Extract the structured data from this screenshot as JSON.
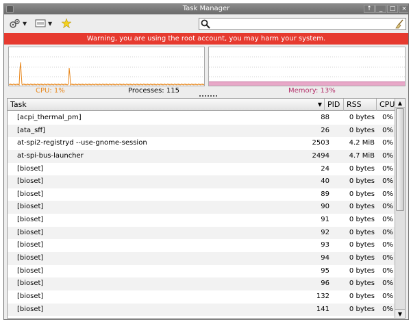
{
  "window": {
    "title": "Task Manager",
    "buttons": {
      "pin": "↑",
      "minimize": "_",
      "maximize": "□",
      "close": "×"
    }
  },
  "toolbar": {
    "items": [
      {
        "name": "settings-menu-icon",
        "has_dropdown": true
      },
      {
        "name": "view-menu-icon",
        "has_dropdown": true
      },
      {
        "name": "about-star-icon",
        "has_dropdown": false
      }
    ],
    "search": {
      "value": "",
      "placeholder": ""
    }
  },
  "warning": {
    "text": "Warning, you are using the root account, you may harm your system.",
    "color": "#e63a2f"
  },
  "status": {
    "cpu_label": "CPU: 1%",
    "processes_label": "Processes: 115",
    "memory_label": "Memory: 13%",
    "cpu_color": "#e8861a",
    "memory_color": "#b4306a"
  },
  "graphs": {
    "cpu": {
      "color": "#e8861a",
      "percent": 1
    },
    "memory": {
      "color": "#e8a8c8",
      "percent": 13
    }
  },
  "table": {
    "columns": {
      "task": "Task",
      "pid": "PID",
      "rss": "RSS",
      "cpu": "CPU"
    },
    "rows": [
      {
        "task": "[acpi_thermal_pm]",
        "pid": "88",
        "rss": "0 bytes",
        "cpu": "0%"
      },
      {
        "task": "[ata_sff]",
        "pid": "26",
        "rss": "0 bytes",
        "cpu": "0%"
      },
      {
        "task": "at-spi2-registryd --use-gnome-session",
        "pid": "2503",
        "rss": "4.2 MiB",
        "cpu": "0%"
      },
      {
        "task": "at-spi-bus-launcher",
        "pid": "2494",
        "rss": "4.7 MiB",
        "cpu": "0%"
      },
      {
        "task": "[bioset]",
        "pid": "24",
        "rss": "0 bytes",
        "cpu": "0%"
      },
      {
        "task": "[bioset]",
        "pid": "40",
        "rss": "0 bytes",
        "cpu": "0%"
      },
      {
        "task": "[bioset]",
        "pid": "89",
        "rss": "0 bytes",
        "cpu": "0%"
      },
      {
        "task": "[bioset]",
        "pid": "90",
        "rss": "0 bytes",
        "cpu": "0%"
      },
      {
        "task": "[bioset]",
        "pid": "91",
        "rss": "0 bytes",
        "cpu": "0%"
      },
      {
        "task": "[bioset]",
        "pid": "92",
        "rss": "0 bytes",
        "cpu": "0%"
      },
      {
        "task": "[bioset]",
        "pid": "93",
        "rss": "0 bytes",
        "cpu": "0%"
      },
      {
        "task": "[bioset]",
        "pid": "94",
        "rss": "0 bytes",
        "cpu": "0%"
      },
      {
        "task": "[bioset]",
        "pid": "95",
        "rss": "0 bytes",
        "cpu": "0%"
      },
      {
        "task": "[bioset]",
        "pid": "96",
        "rss": "0 bytes",
        "cpu": "0%"
      },
      {
        "task": "[bioset]",
        "pid": "132",
        "rss": "0 bytes",
        "cpu": "0%"
      },
      {
        "task": "[bioset]",
        "pid": "141",
        "rss": "0 bytes",
        "cpu": "0%"
      }
    ]
  }
}
